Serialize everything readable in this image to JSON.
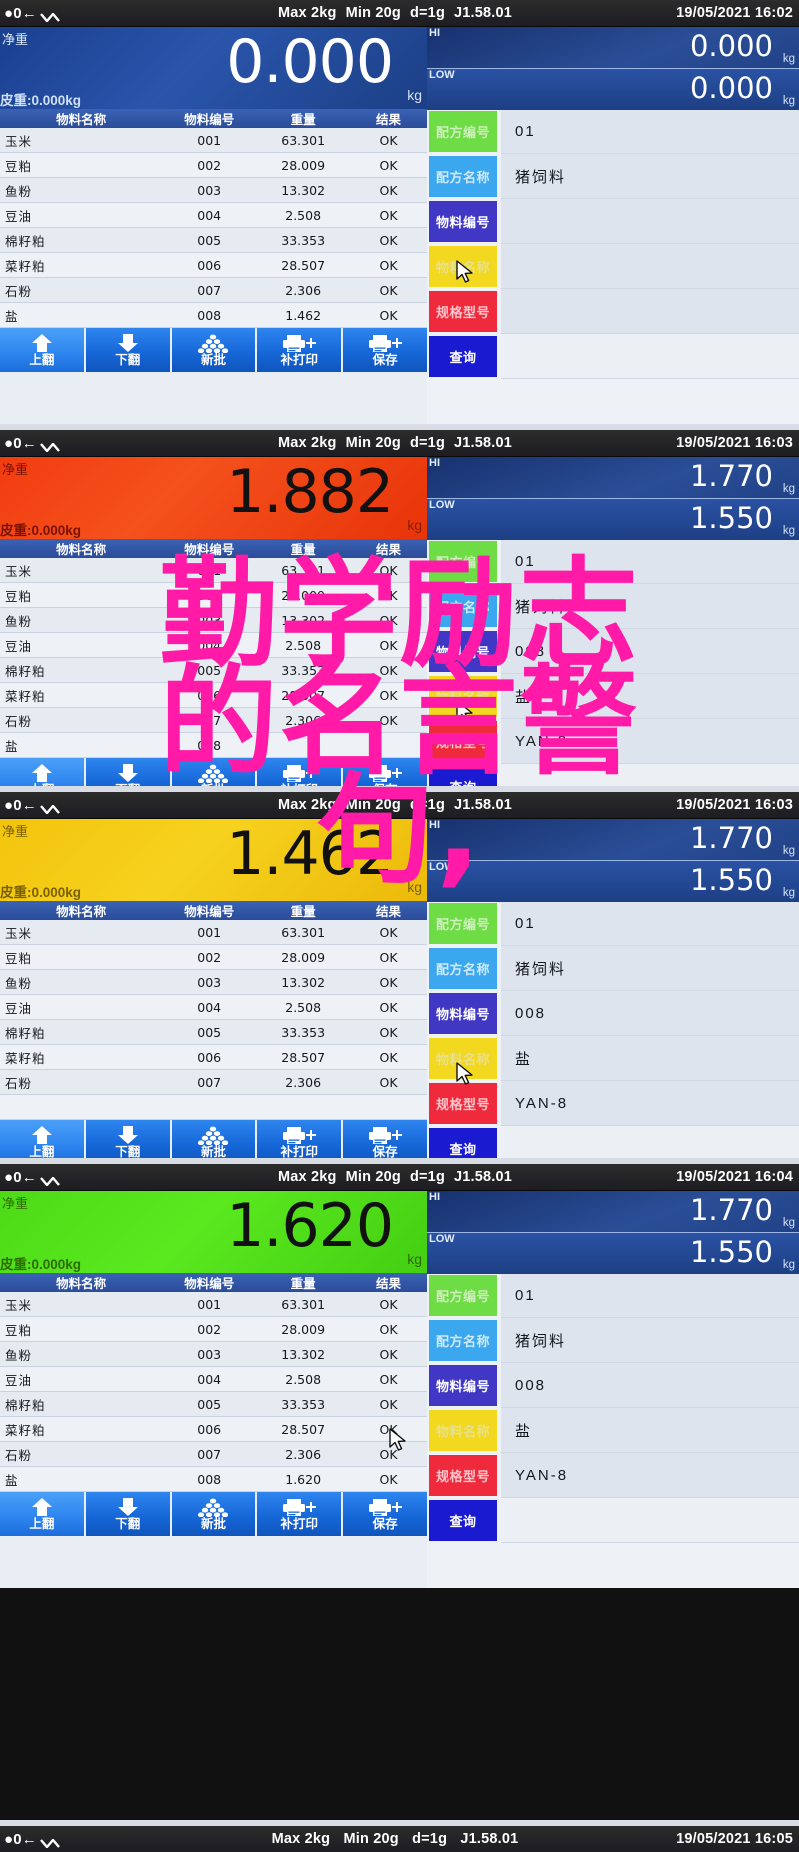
{
  "device": {
    "statusbar": {
      "zero_icon": "zero-indicator-icon",
      "stable_icon": "stability-icon",
      "max": "Max 2kg",
      "min": "Min 20g",
      "division": "d=1g",
      "firmware": "J1.58.01"
    },
    "labels": {
      "net": "净重",
      "tare": "皮重:0.000kg",
      "unit": "kg",
      "hi": "HI",
      "low": "LOW"
    },
    "table_headers": [
      "物料名称",
      "物料编号",
      "重量",
      "结果"
    ],
    "toolbar": [
      {
        "label": "上翻",
        "icon": "arrow-up-icon"
      },
      {
        "label": "下翻",
        "icon": "arrow-down-icon"
      },
      {
        "label": "新批",
        "icon": "stack-pile-icon"
      },
      {
        "label": "补打印",
        "icon": "printer-plus-icon"
      },
      {
        "label": "保存",
        "icon": "printer-save-icon"
      }
    ],
    "field_keys": [
      "配方编号",
      "配方名称",
      "物料编号",
      "物料名称",
      "规格型号"
    ],
    "query_label": "查询"
  },
  "panels": [
    {
      "id": "panel-1",
      "datetime": "19/05/2021  16:02",
      "weight": "0.000",
      "weight_color": "dark",
      "hi": "0.000",
      "low": "0.000",
      "fields": {
        "formula_no": "01",
        "formula_name": "猪饲料",
        "material_no": "",
        "material_name": "",
        "spec_model": ""
      },
      "rows": [
        {
          "name": "玉米",
          "no": "001",
          "weight": "63.301",
          "result": "OK"
        },
        {
          "name": "豆粕",
          "no": "002",
          "weight": "28.009",
          "result": "OK"
        },
        {
          "name": "鱼粉",
          "no": "003",
          "weight": "13.302",
          "result": "OK"
        },
        {
          "name": "豆油",
          "no": "004",
          "weight": "2.508",
          "result": "OK"
        },
        {
          "name": "棉籽粕",
          "no": "005",
          "weight": "33.353",
          "result": "OK"
        },
        {
          "name": "菜籽粕",
          "no": "006",
          "weight": "28.507",
          "result": "OK"
        },
        {
          "name": "石粉",
          "no": "007",
          "weight": "2.306",
          "result": "OK"
        },
        {
          "name": "盐",
          "no": "008",
          "weight": "1.462",
          "result": "OK"
        }
      ]
    },
    {
      "id": "panel-2",
      "datetime": "19/05/2021  16:03",
      "weight": "1.882",
      "weight_color": "red",
      "hi": "1.770",
      "low": "1.550",
      "fields": {
        "formula_no": "01",
        "formula_name": "猪饲料",
        "material_no": "008",
        "material_name": "盐",
        "spec_model": "YAN-8"
      },
      "rows": [
        {
          "name": "玉米",
          "no": "001",
          "weight": "63.301",
          "result": "OK"
        },
        {
          "name": "豆粕",
          "no": "002",
          "weight": "28.009",
          "result": "OK"
        },
        {
          "name": "鱼粉",
          "no": "003",
          "weight": "13.302",
          "result": "OK"
        },
        {
          "name": "豆油",
          "no": "004",
          "weight": "2.508",
          "result": "OK"
        },
        {
          "name": "棉籽粕",
          "no": "005",
          "weight": "33.353",
          "result": "OK"
        },
        {
          "name": "菜籽粕",
          "no": "006",
          "weight": "28.507",
          "result": "OK"
        },
        {
          "name": "石粉",
          "no": "007",
          "weight": "2.306",
          "result": "OK"
        },
        {
          "name": "盐",
          "no": "008",
          "weight": "",
          "result": ""
        }
      ]
    },
    {
      "id": "panel-3",
      "datetime": "19/05/2021  16:03",
      "weight": "1.462",
      "weight_color": "yellow",
      "hi": "1.770",
      "low": "1.550",
      "fields": {
        "formula_no": "01",
        "formula_name": "猪饲料",
        "material_no": "008",
        "material_name": "盐",
        "spec_model": "YAN-8"
      },
      "rows": [
        {
          "name": "玉米",
          "no": "001",
          "weight": "63.301",
          "result": "OK"
        },
        {
          "name": "豆粕",
          "no": "002",
          "weight": "28.009",
          "result": "OK"
        },
        {
          "name": "鱼粉",
          "no": "003",
          "weight": "13.302",
          "result": "OK"
        },
        {
          "name": "豆油",
          "no": "004",
          "weight": "2.508",
          "result": "OK"
        },
        {
          "name": "棉籽粕",
          "no": "005",
          "weight": "33.353",
          "result": "OK"
        },
        {
          "name": "菜籽粕",
          "no": "006",
          "weight": "28.507",
          "result": "OK"
        },
        {
          "name": "石粉",
          "no": "007",
          "weight": "2.306",
          "result": "OK"
        },
        {
          "name": "",
          "no": "",
          "weight": "",
          "result": ""
        }
      ]
    },
    {
      "id": "panel-4",
      "datetime": "19/05/2021  16:04",
      "weight": "1.620",
      "weight_color": "green",
      "hi": "1.770",
      "low": "1.550",
      "fields": {
        "formula_no": "01",
        "formula_name": "猪饲料",
        "material_no": "008",
        "material_name": "盐",
        "spec_model": "YAN-8"
      },
      "rows": [
        {
          "name": "玉米",
          "no": "001",
          "weight": "63.301",
          "result": "OK"
        },
        {
          "name": "豆粕",
          "no": "002",
          "weight": "28.009",
          "result": "OK"
        },
        {
          "name": "鱼粉",
          "no": "003",
          "weight": "13.302",
          "result": "OK"
        },
        {
          "name": "豆油",
          "no": "004",
          "weight": "2.508",
          "result": "OK"
        },
        {
          "name": "棉籽粕",
          "no": "005",
          "weight": "33.353",
          "result": "OK"
        },
        {
          "name": "菜籽粕",
          "no": "006",
          "weight": "28.507",
          "result": "OK"
        },
        {
          "name": "石粉",
          "no": "007",
          "weight": "2.306",
          "result": "OK"
        },
        {
          "name": "盐",
          "no": "008",
          "weight": "1.620",
          "result": "OK"
        }
      ]
    }
  ],
  "footer": {
    "datetime": "19/05/2021  16:05",
    "max": "Max 2kg",
    "min": "Min 20g",
    "division": "d=1g",
    "firmware": "J1.58.01"
  },
  "watermark": {
    "text": "勤学励志\n的名言警\n句,",
    "color": "#ff1aa8"
  }
}
